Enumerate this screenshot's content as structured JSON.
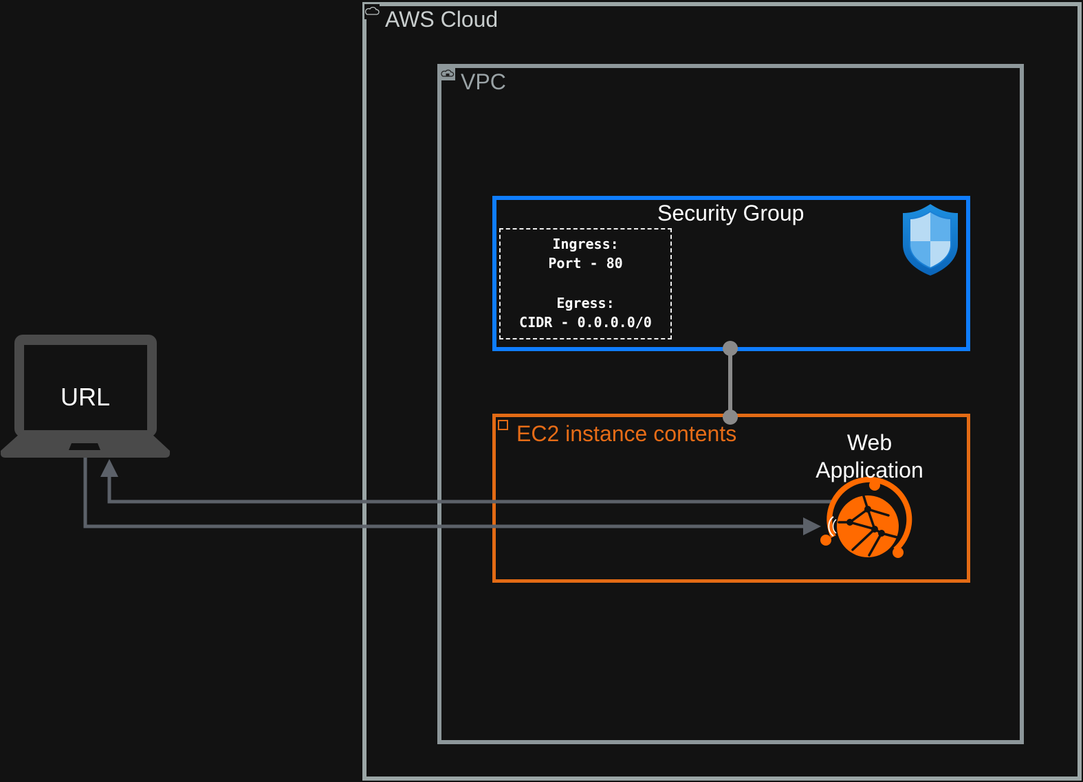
{
  "aws_cloud": {
    "label": "AWS Cloud",
    "icon": "cloud-icon",
    "border_color": "#9ba6a6"
  },
  "vpc": {
    "label": "VPC",
    "icon": "vpc-lock-cloud-icon",
    "border_color": "#8d979a"
  },
  "security_group": {
    "title": "Security Group",
    "icon": "shield-icon",
    "border_color": "#0f7dff",
    "rules": {
      "ingress_label": "Ingress:",
      "ingress_value": "Port - 80",
      "egress_label": "Egress:",
      "egress_value": "CIDR - 0.0.0.0/0"
    }
  },
  "ec2": {
    "label": "EC2 instance contents",
    "icon": "ec2-chip-icon",
    "border_color": "#e36b15",
    "web_app": {
      "label": "Web Application",
      "icon": "web-app-globe-icon",
      "color": "#ff6a00"
    }
  },
  "client": {
    "label": "URL",
    "icon": "laptop-icon",
    "color": "#4a4a4a"
  },
  "connectors": {
    "color": "#5c6169",
    "link_color": "#8a8a8a"
  }
}
